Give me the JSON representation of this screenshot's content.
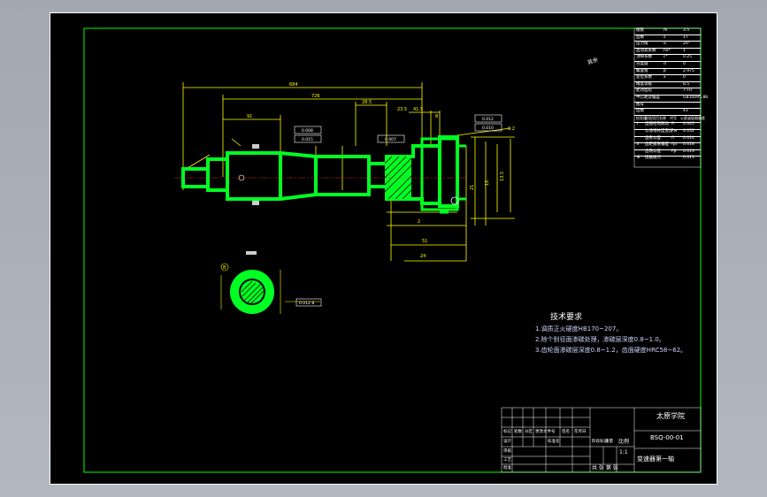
{
  "colors": {
    "background": "#a7abb5",
    "paper": "#000000",
    "border": "#00ff00",
    "part": "#00ff22",
    "dimension": "#ffff00",
    "text": "#ffffff"
  },
  "drawing": {
    "tech_title": "技术要求",
    "tech_notes": [
      "1.调质正火硬度HB170~207。",
      "2.除个别径面渗碳处理，渗碳层深度0.8~1.0。",
      "3.齿轮面渗碳层深度0.8~1.2，齿面硬度HRC58~62。"
    ],
    "roughness_note": "其余",
    "dims": {
      "overall_length": "684",
      "length_2": "726",
      "length_3": "91",
      "d1": "28.5",
      "d2": "23.5",
      "d3": "41.5",
      "d4": "8",
      "d5": "2",
      "d6": "51",
      "d7": "24",
      "d8": "21",
      "d9": "12",
      "d10": "13.5",
      "d11": "9.2"
    },
    "tolerances": [
      "0.008",
      "0.015",
      "0.007",
      "0.012",
      "0.010"
    ],
    "section_label": "B",
    "section_tol": "0.012 B"
  },
  "gear_table": {
    "rows": [
      {
        "name": "模数",
        "sym": "m",
        "val": "3.5"
      },
      {
        "name": "齿数",
        "sym": "z",
        "val": "17"
      },
      {
        "name": "压力角",
        "sym": "α",
        "val": "20°"
      },
      {
        "name": "齿顶高系数",
        "sym": "ha*",
        "val": "1"
      },
      {
        "name": "顶隙系数",
        "sym": "c*",
        "val": "0.25"
      },
      {
        "name": "分度圆",
        "sym": "d",
        "val": "0"
      },
      {
        "name": "螺旋角",
        "sym": "β",
        "val": "2.975"
      },
      {
        "name": "变位系数",
        "sym": "x",
        "val": "0"
      },
      {
        "name": "精度等级",
        "sym": "",
        "val": "8.5"
      },
      {
        "name": "配对齿轮",
        "sym": "",
        "val": "7-FH"
      },
      {
        "name": "中心距及偏差",
        "sym": "",
        "val": "GB10095.88"
      },
      {
        "name": "图号",
        "sym": "",
        "val": ""
      },
      {
        "name": "齿数",
        "sym": "",
        "val": "43"
      }
    ],
    "check_rows": [
      {
        "group": "Ⅰ",
        "name": "齿圈径向跳动",
        "sym": "Fr",
        "val": "0.045"
      },
      {
        "name": "公法线长度变动",
        "sym": "Fw",
        "val": "0.032"
      },
      {
        "name": "齿形公差",
        "sym": "ff",
        "val": "0.014"
      },
      {
        "group": "Ⅱ",
        "name": "齿距极限偏差",
        "sym": "fpt",
        "val": "0.018"
      },
      {
        "name": "齿向公差",
        "sym": "Fβ",
        "val": "0.013"
      },
      {
        "group": "Ⅲ",
        "name": "接触斑点",
        "sym": "",
        "val": "0.011"
      }
    ],
    "header": [
      "检验组",
      "检验项目名称",
      "代号",
      "公差或极限偏差"
    ]
  },
  "title_block": {
    "school": "太原学院",
    "drawing_no": "BSQ-00-01",
    "part_name": "变速器第一轴",
    "scale_label": "比例",
    "scale": "1:1",
    "sheet_label": "共  张 第  张",
    "headers": [
      "标记",
      "处数",
      "分区",
      "更改文件号",
      "签名",
      "年月日"
    ],
    "roles": [
      "设计",
      "审核",
      "工艺",
      "批准"
    ],
    "standard_label": "标准化",
    "stage_label": "阶段标记",
    "weight_label": "重量"
  }
}
